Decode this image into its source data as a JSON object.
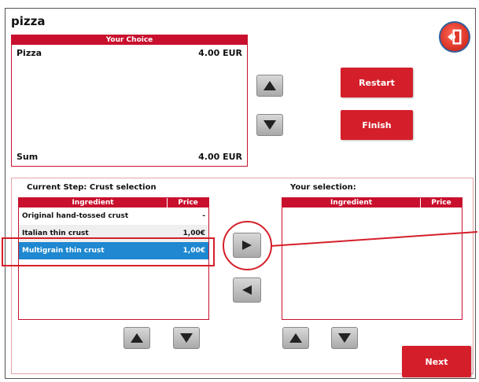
{
  "app": {
    "title": "pizza"
  },
  "choice": {
    "header": "Your Choice",
    "item_name": "Pizza",
    "item_price": "4.00 EUR",
    "sum_label": "Sum",
    "sum_value": "4.00 EUR"
  },
  "buttons": {
    "restart": "Restart",
    "finish": "Finish",
    "next": "Next"
  },
  "current_step": {
    "label": "Current Step: Crust selection",
    "col_ingredient": "Ingredient",
    "col_price": "Price",
    "rows": [
      {
        "name": "Original hand-tossed crust",
        "price": "-"
      },
      {
        "name": "Italian thin crust",
        "price": "1,00€"
      },
      {
        "name": "Multigrain thin crust",
        "price": "1,00€"
      }
    ],
    "selected_index": 2
  },
  "your_selection": {
    "label": "Your selection:",
    "col_ingredient": "Ingredient",
    "col_price": "Price"
  },
  "icons": {
    "exit": "exit-door-icon",
    "up": "triangle-up-icon",
    "down": "triangle-down-icon",
    "right": "triangle-right-icon",
    "left": "triangle-left-icon"
  },
  "colors": {
    "accent": "#d41f2a",
    "selection": "#1f88d0"
  }
}
